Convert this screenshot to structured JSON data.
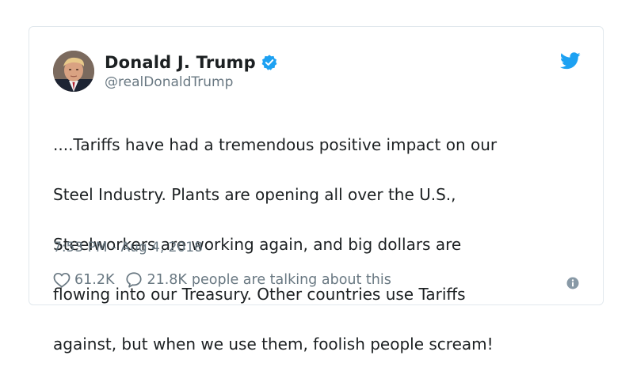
{
  "tweet": {
    "display_name": "Donald J. Trump",
    "handle": "@realDonaldTrump",
    "lines": [
      "....Tariffs have had a tremendous positive impact on our",
      "Steel Industry. Plants are opening all over the U.S.,",
      "Steelworkers are working again, and big dollars are",
      "flowing into our Treasury. Other countries use Tariffs",
      "against, but when we use them, foolish people scream!"
    ],
    "timestamp": "7:53 PM - Aug 4, 2018",
    "likes": "61.2K",
    "replies": "21.8K",
    "talking_label": "people are talking about this"
  },
  "icons": {
    "avatar": "avatar",
    "verified": "verified-badge-icon",
    "brand": "twitter-bird-icon",
    "like": "heart-icon",
    "reply": "speech-bubble-icon",
    "info": "info-icon"
  },
  "colors": {
    "brand_blue": "#1da1f2",
    "text": "#1c2022",
    "secondary": "#697882",
    "border": "#e1e8ed"
  }
}
